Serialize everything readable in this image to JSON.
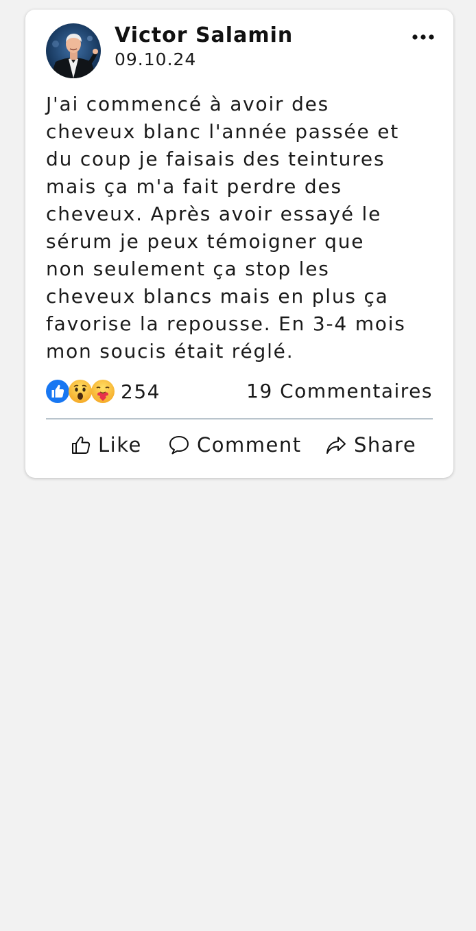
{
  "post": {
    "author": "Victor Salamin",
    "date": "09.10.24",
    "text_lines": [
      "J'ai commencé à avoir des",
      "cheveux blanc l'année passée et",
      "du coup je faisais des teintures",
      "mais ça m'a fait perdre des",
      "cheveux. Après avoir essayé le",
      "sérum je peux témoigner que",
      "non seulement ça stop les",
      "cheveux blancs mais en plus ça",
      "favorise la repousse. En 3-4 mois",
      "mon soucis était réglé."
    ],
    "reactions": {
      "icons": [
        "like-reaction-icon",
        "wow-reaction-icon",
        "care-reaction-icon"
      ],
      "count": "254"
    },
    "comments_count": "19 Commentaires"
  },
  "actions": {
    "like": "Like",
    "comment": "Comment",
    "share": "Share"
  },
  "icons": {
    "more": "more-options-icon",
    "like": "thumbs-up-icon",
    "comment": "speech-bubble-icon",
    "share": "share-arrow-icon"
  },
  "colors": {
    "page_background": "#f2f2f2",
    "card_background": "#ffffff",
    "text": "#1a1a1a",
    "like_blue": "#1877f2",
    "divider": "#b9c4cc"
  }
}
